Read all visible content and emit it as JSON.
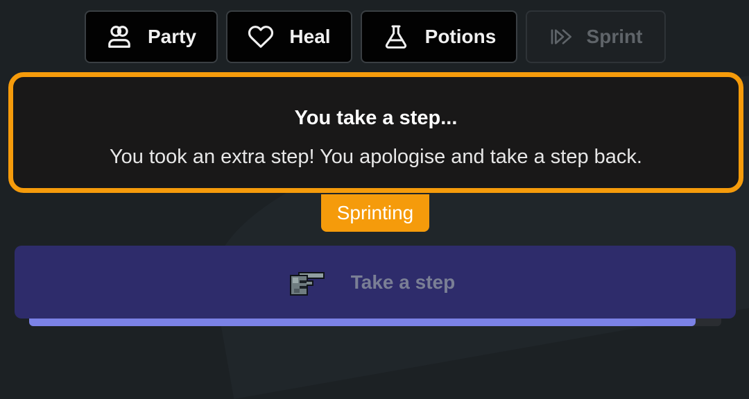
{
  "toolbar": {
    "party": {
      "label": "Party",
      "icon": "users-icon"
    },
    "heal": {
      "label": "Heal",
      "icon": "heart-icon"
    },
    "potions": {
      "label": "Potions",
      "icon": "flask-icon"
    },
    "sprint": {
      "label": "Sprint",
      "icon": "fast-forward-icon",
      "disabled": true
    }
  },
  "message": {
    "title": "You take a step...",
    "body": "You took an extra step! You apologise and take a step back."
  },
  "status": {
    "label": "Sprinting"
  },
  "action": {
    "label": "Take a step",
    "icon": "pointing-hand-icon",
    "disabled": true
  },
  "progress": {
    "fraction": 0.963
  },
  "colors": {
    "accent": "#f59b0b",
    "action_bg": "#2e2c6b",
    "progress": "#7b82e6",
    "background": "#1c2124"
  }
}
